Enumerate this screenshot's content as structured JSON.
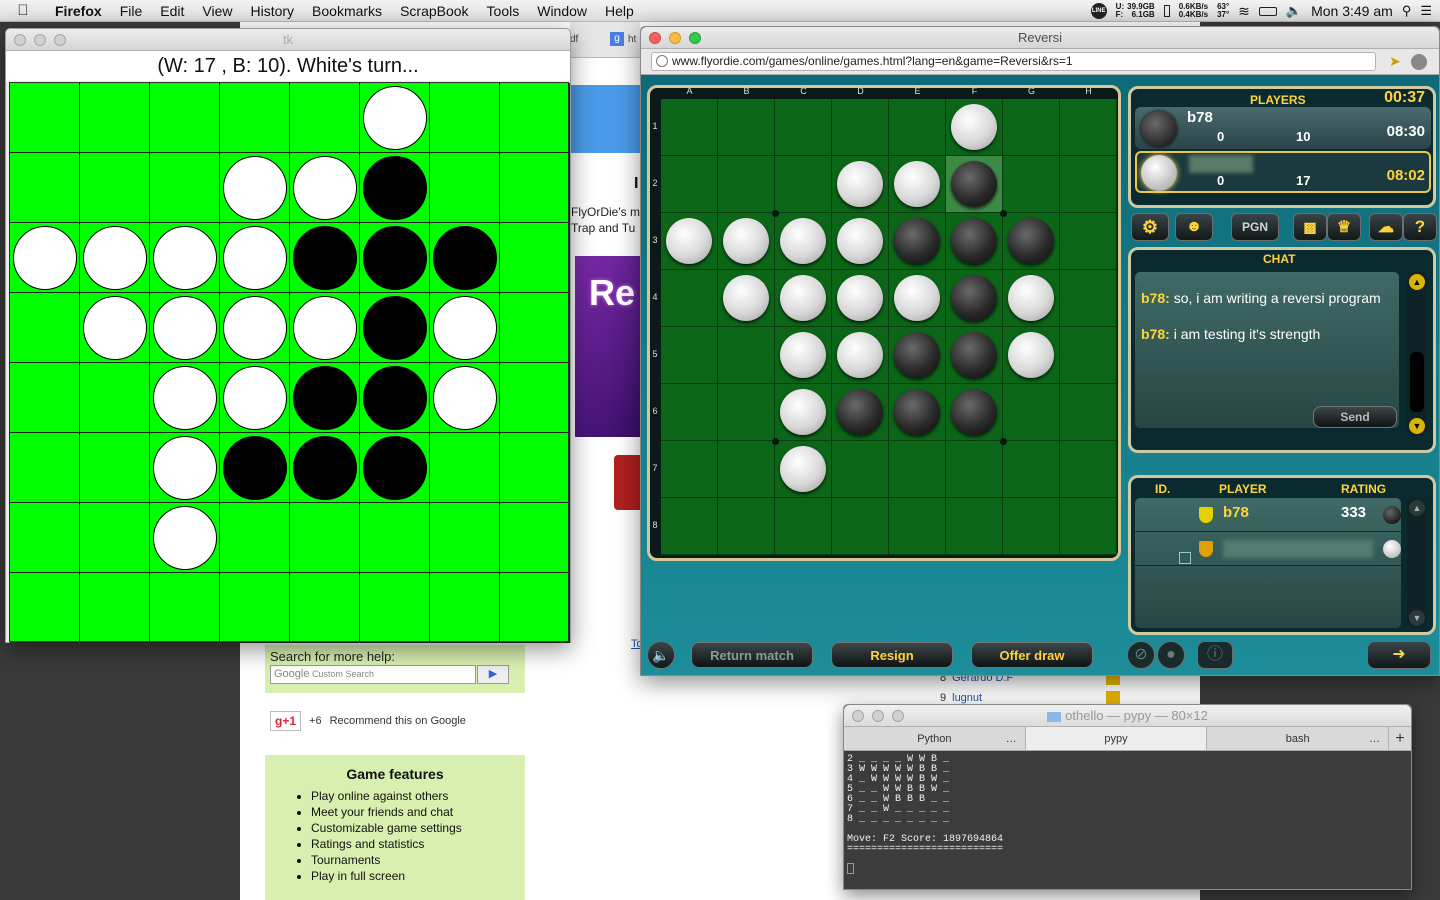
{
  "menubar": {
    "app": "Firefox",
    "items": [
      "File",
      "Edit",
      "View",
      "History",
      "Bookmarks",
      "ScrapBook",
      "Tools",
      "Window",
      "Help"
    ],
    "disk": {
      "u": "39.9GB",
      "f": "6.1GB",
      "u_label": "U:",
      "f_label": "F:"
    },
    "net": {
      "up": "0.6KB/s",
      "down": "0.4KB/s"
    },
    "temps": {
      "a": "63°",
      "b": "37°"
    },
    "clock": "Mon 3:49 am"
  },
  "background_page": {
    "tab_partial": "df",
    "tab2_partial": "ht",
    "partial_text1": "FlyOrDie's m",
    "partial_text2": "Trap and Tu",
    "partial_banner": "Re",
    "search_label": "Search for more help:",
    "search_placeholder": "Custom Search",
    "google_label": "Google",
    "gplus_label": "g+1",
    "gplus_count": "+6",
    "gplus_text": "Recommend this on Google",
    "features_title": "Game features",
    "features": [
      "Play online against others",
      "Meet your friends and chat",
      "Customizable game settings",
      "Ratings and statistics",
      "Tournaments",
      "Play in full screen"
    ],
    "ranking_rows": [
      {
        "rank": "8",
        "name": "Gerardo D.F"
      },
      {
        "rank": "9",
        "name": "lugnut"
      }
    ],
    "partial_link": "To"
  },
  "tk_window": {
    "title": "tk",
    "status": "(W: 17 , B: 10).  White's turn...",
    "board": [
      "_____W__",
      "___WWB__",
      "WWWWBBB_",
      "_WWWWBW_",
      "__WWBBW_",
      "__WBBB__",
      "__W_____",
      "________"
    ]
  },
  "reversi_window": {
    "title": "Reversi",
    "url": "www.flyordie.com/games/online/games.html?lang=en&game=Reversi&rs=1",
    "columns": [
      "A",
      "B",
      "C",
      "D",
      "E",
      "F",
      "G",
      "H"
    ],
    "rows": [
      "1",
      "2",
      "3",
      "4",
      "5",
      "6",
      "7",
      "8"
    ],
    "board": [
      "_____W__",
      "___WWB__",
      "WWWWBBB_",
      "_WWWWBW_",
      "__WWBBW_",
      "__WBBB__",
      "__W_____",
      "________"
    ],
    "players": {
      "title": "PLAYERS",
      "timer": "00:37",
      "p1": {
        "name": "b78",
        "col1": "0",
        "col2": "10",
        "time": "08:30"
      },
      "p2": {
        "name": "",
        "col1": "0",
        "col2": "17",
        "time": "08:02"
      }
    },
    "toolbar": {
      "pgn": "PGN"
    },
    "chat": {
      "title": "CHAT",
      "messages": [
        {
          "user": "b78:",
          "text": "so, i am writing a reversi program"
        },
        {
          "user": "b78:",
          "text": "i am testing it's strength"
        }
      ],
      "send": "Send"
    },
    "list": {
      "headers": [
        "ID.",
        "PLAYER",
        "RATING"
      ],
      "rows": [
        {
          "player": "b78",
          "rating": "333"
        }
      ]
    },
    "buttons": {
      "return_match": "Return match",
      "resign": "Resign",
      "offer_draw": "Offer draw"
    },
    "colors": {
      "accent": "#ffd43b",
      "board": "#0c6618"
    }
  },
  "terminal": {
    "title": "othello — pypy — 80×12",
    "tabs": [
      "Python",
      "pypy",
      "bash"
    ],
    "lines": [
      "2 _ _ _ _ W W B _",
      "3 W W W W W B B _",
      "4 _ W W W W B W _",
      "5 _ _ W W B B W _",
      "6 _ _ W B B B _ _",
      "7 _ _ W _ _ _ _ _",
      "8 _ _ _ _ _ _ _ _",
      "",
      "Move: F2 Score: 1897694864",
      "=========================="
    ]
  }
}
